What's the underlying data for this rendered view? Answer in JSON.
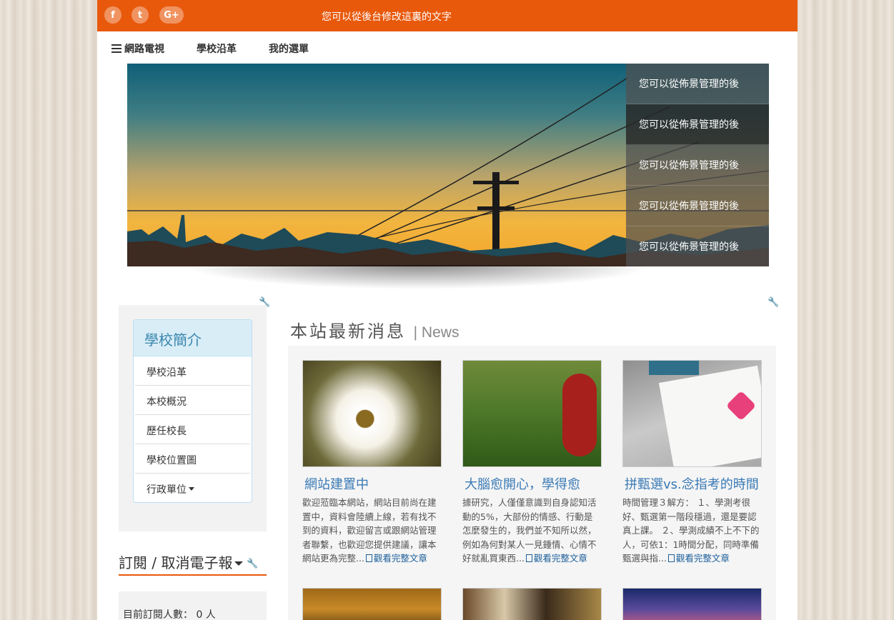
{
  "topbar": {
    "social": [
      "f",
      "t",
      "G+"
    ],
    "message": "您可以從後台修改這裏的文字"
  },
  "nav": {
    "items": [
      "網路電視",
      "學校沿革",
      "我的選單"
    ]
  },
  "banner": {
    "menu": [
      "您可以從佈景管理的後",
      "您可以從佈景管理的後",
      "您可以從佈景管理的後",
      "您可以從佈景管理的後",
      "您可以從佈景管理的後"
    ]
  },
  "sidebar": {
    "intro_title": "學校簡介",
    "intro_items": [
      "學校沿革",
      "本校概況",
      "歷任校長",
      "學校位置圖",
      "行政單位"
    ],
    "subscribe_title": "訂閱 / 取消電子報",
    "subscribe_count_label": "目前訂閱人數：",
    "subscribe_count": "0 人"
  },
  "news": {
    "title": "本站最新消息",
    "title_en": "| News",
    "more_label": "觀看完整文章",
    "cards": [
      {
        "title": "網站建置中",
        "text": "歡迎蒞臨本網站，網站目前尚在建置中，資料會陸續上線，若有找不到的資料，歡迎留言或跟網站管理者聯繫，也歡迎您提供建議，讓本網站更為完整..."
      },
      {
        "title": "大腦愈開心，學得愈",
        "text": "據研究，人僅僅意識到自身認知活動的5%，大部份的情感、行動是怎麼發生的，我們並不知所以然，例如為何對某人一見鍾情、心情不好就亂買東西..."
      },
      {
        "title": "拼甄選vs.念指考的時間",
        "text": "時間管理３解方： １、學測考很好、甄選第一階段穩過，還是要認真上課。 ２、學測成績不上不下的人，可依1：1時間分配，同時準備甄選與指..."
      }
    ]
  }
}
